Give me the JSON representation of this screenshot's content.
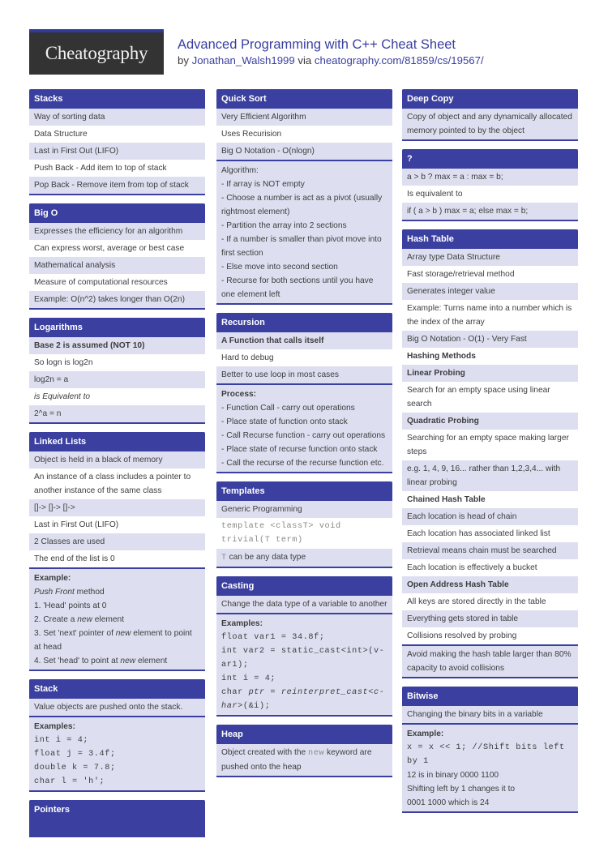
{
  "header": {
    "logo": "Cheatography",
    "title": "Advanced Programming with C++ Cheat Sheet",
    "by": "by",
    "author": "Jonathan_Walsh1999",
    "via": "via",
    "url": "cheatography.com/81859/cs/19567/"
  },
  "stacks": {
    "title": "Stacks",
    "rows": [
      "Way of sorting data",
      "Data Structure",
      "Last in First Out (LIFO)",
      "Push Back - Add item to top of stack",
      "Pop Back - Remove item from top of stack"
    ]
  },
  "bigo": {
    "title": "Big O",
    "rows": [
      "Expresses the efficiency for an algorithm",
      "Can express worst, average or best case",
      "Mathematical analysis",
      "Measure of computational resources",
      "Example: O(n^2) takes longer than O(2n)"
    ]
  },
  "logarithms": {
    "title": "Logarithms",
    "rows": [
      "Base 2 is assumed (NOT 10)",
      "So logn is log2n",
      "log2n = a",
      "is Equivalent to",
      "2^a = n"
    ]
  },
  "linked_lists": {
    "title": "Linked Lists",
    "rows": [
      "Object is held in a black of memory",
      "An instance of a class includes a pointer to another instance of the same class",
      "[]-> []-> []->",
      "Last in First Out (LIFO)",
      "2 Classes are used",
      "The end of the list is 0"
    ],
    "example_label": "Example:",
    "push_front": "Push Front",
    "method": " method",
    "steps": {
      "s1": "1. 'Head' points at 0",
      "s2a": "2. Create a ",
      "s2b": "new",
      "s2c": " element",
      "s3a": "3. Set 'next' pointer of ",
      "s3b": "new",
      "s3c": " element to point at head",
      "s4a": "4. Set 'head' to point at ",
      "s4b": "new",
      "s4c": " element"
    }
  },
  "stack": {
    "title": "Stack",
    "rows": [
      "Value objects are pushed onto the stack."
    ],
    "examples_label": "Examples:",
    "code": [
      "int i = 4;",
      "float j = 3.4f;",
      "double k = 7.8;",
      "char l = 'h';"
    ]
  },
  "pointers": {
    "title": "Pointers"
  },
  "quick_sort": {
    "title": "Quick Sort",
    "rows": [
      "Very Efficient Algorithm",
      "Uses Recurision",
      "Big O Notation - O(nlogn)"
    ],
    "algorithm": [
      "Algorithm:",
      "- If array is NOT empty",
      "- Choose a number is act as a pivot (usually rightmost element)",
      "- Partition the array into 2 sections",
      "- If a number is smaller than pivot move into first section",
      "- Else move into second section",
      "- Recurse for both sections until you have one element left"
    ]
  },
  "recursion": {
    "title": "Recursion",
    "rows": [
      "A Function that calls itself",
      "Hard to debug",
      "Better to use loop in most cases"
    ],
    "process_label": "Process:",
    "process": [
      "- Function Call - carry out operations",
      "- Place state of function onto stack",
      "- Call Recurse function - carry out operations",
      "- Place state of recurse function onto stack",
      "- Call the recurse of the recurse function etc."
    ]
  },
  "templates": {
    "title": "Templates",
    "rows": [
      "Generic Programming"
    ],
    "code": "template <classT> void trivial(T term)",
    "t_code": "T",
    "t_text": " can be any data type"
  },
  "casting": {
    "title": "Casting",
    "rows": [
      "Change the data type of a variable to another"
    ],
    "examples_label": "Examples:",
    "code": [
      "float var1 = 34.8f;",
      "int var2 = static_cast<int>(v-ar1);",
      "int i = 4;"
    ],
    "last_a": "char ",
    "last_b": "ptr",
    "last_c": " = ",
    "last_d": "reinterpret_cast<c-har>",
    "last_e": "(&i);"
  },
  "heap": {
    "title": "Heap",
    "text_a": "Object created with the ",
    "text_code": "new",
    "text_b": " keyword are pushed onto the heap"
  },
  "deep_copy": {
    "title": "Deep Copy",
    "rows": [
      "Copy of object and any dynamically allocated memory pointed to by the object"
    ]
  },
  "ternary": {
    "title": "?",
    "rows": [
      "a > b ? max = a : max = b;",
      "Is equivalent to",
      "if ( a > b ) max = a; else max = b;"
    ]
  },
  "hash_table": {
    "title": "Hash Table",
    "rows": [
      "Array type Data Structure",
      "Fast storage/retrieval method",
      "Generates integer value",
      "Example: Turns name into a number which is the index of the array",
      "Big O Notation - O(1) - Very Fast",
      "Hashing Methods",
      "Linear Probing",
      "Search for an empty space using linear search",
      "Quadratic Probing",
      "Searching for an empty space making larger steps",
      "e.g. 1, 4, 9, 16... rather than 1,2,3,4... with linear probing",
      "Chained Hash Table",
      "Each location is head of chain",
      "Each location has associated linked list",
      "Retrieval means chain must be searched",
      "Each location is effectively a bucket",
      "Open Address Hash Table",
      "All keys are stored directly in the table",
      "Everything gets stored in table",
      "Collisions resolved by probing"
    ],
    "note": "Avoid making the hash table larger than 80% capacity to avoid collisions"
  },
  "bitwise": {
    "title": "Bitwise",
    "rows": [
      "Changing the binary bits in a variable"
    ],
    "example_label": "Example:",
    "code": "x = x << 1; //Shift bits left by 1",
    "lines": [
      "12 is in binary 0000 1100",
      "Shifting left by 1 changes it to",
      "0001 1000 which is 24"
    ]
  }
}
